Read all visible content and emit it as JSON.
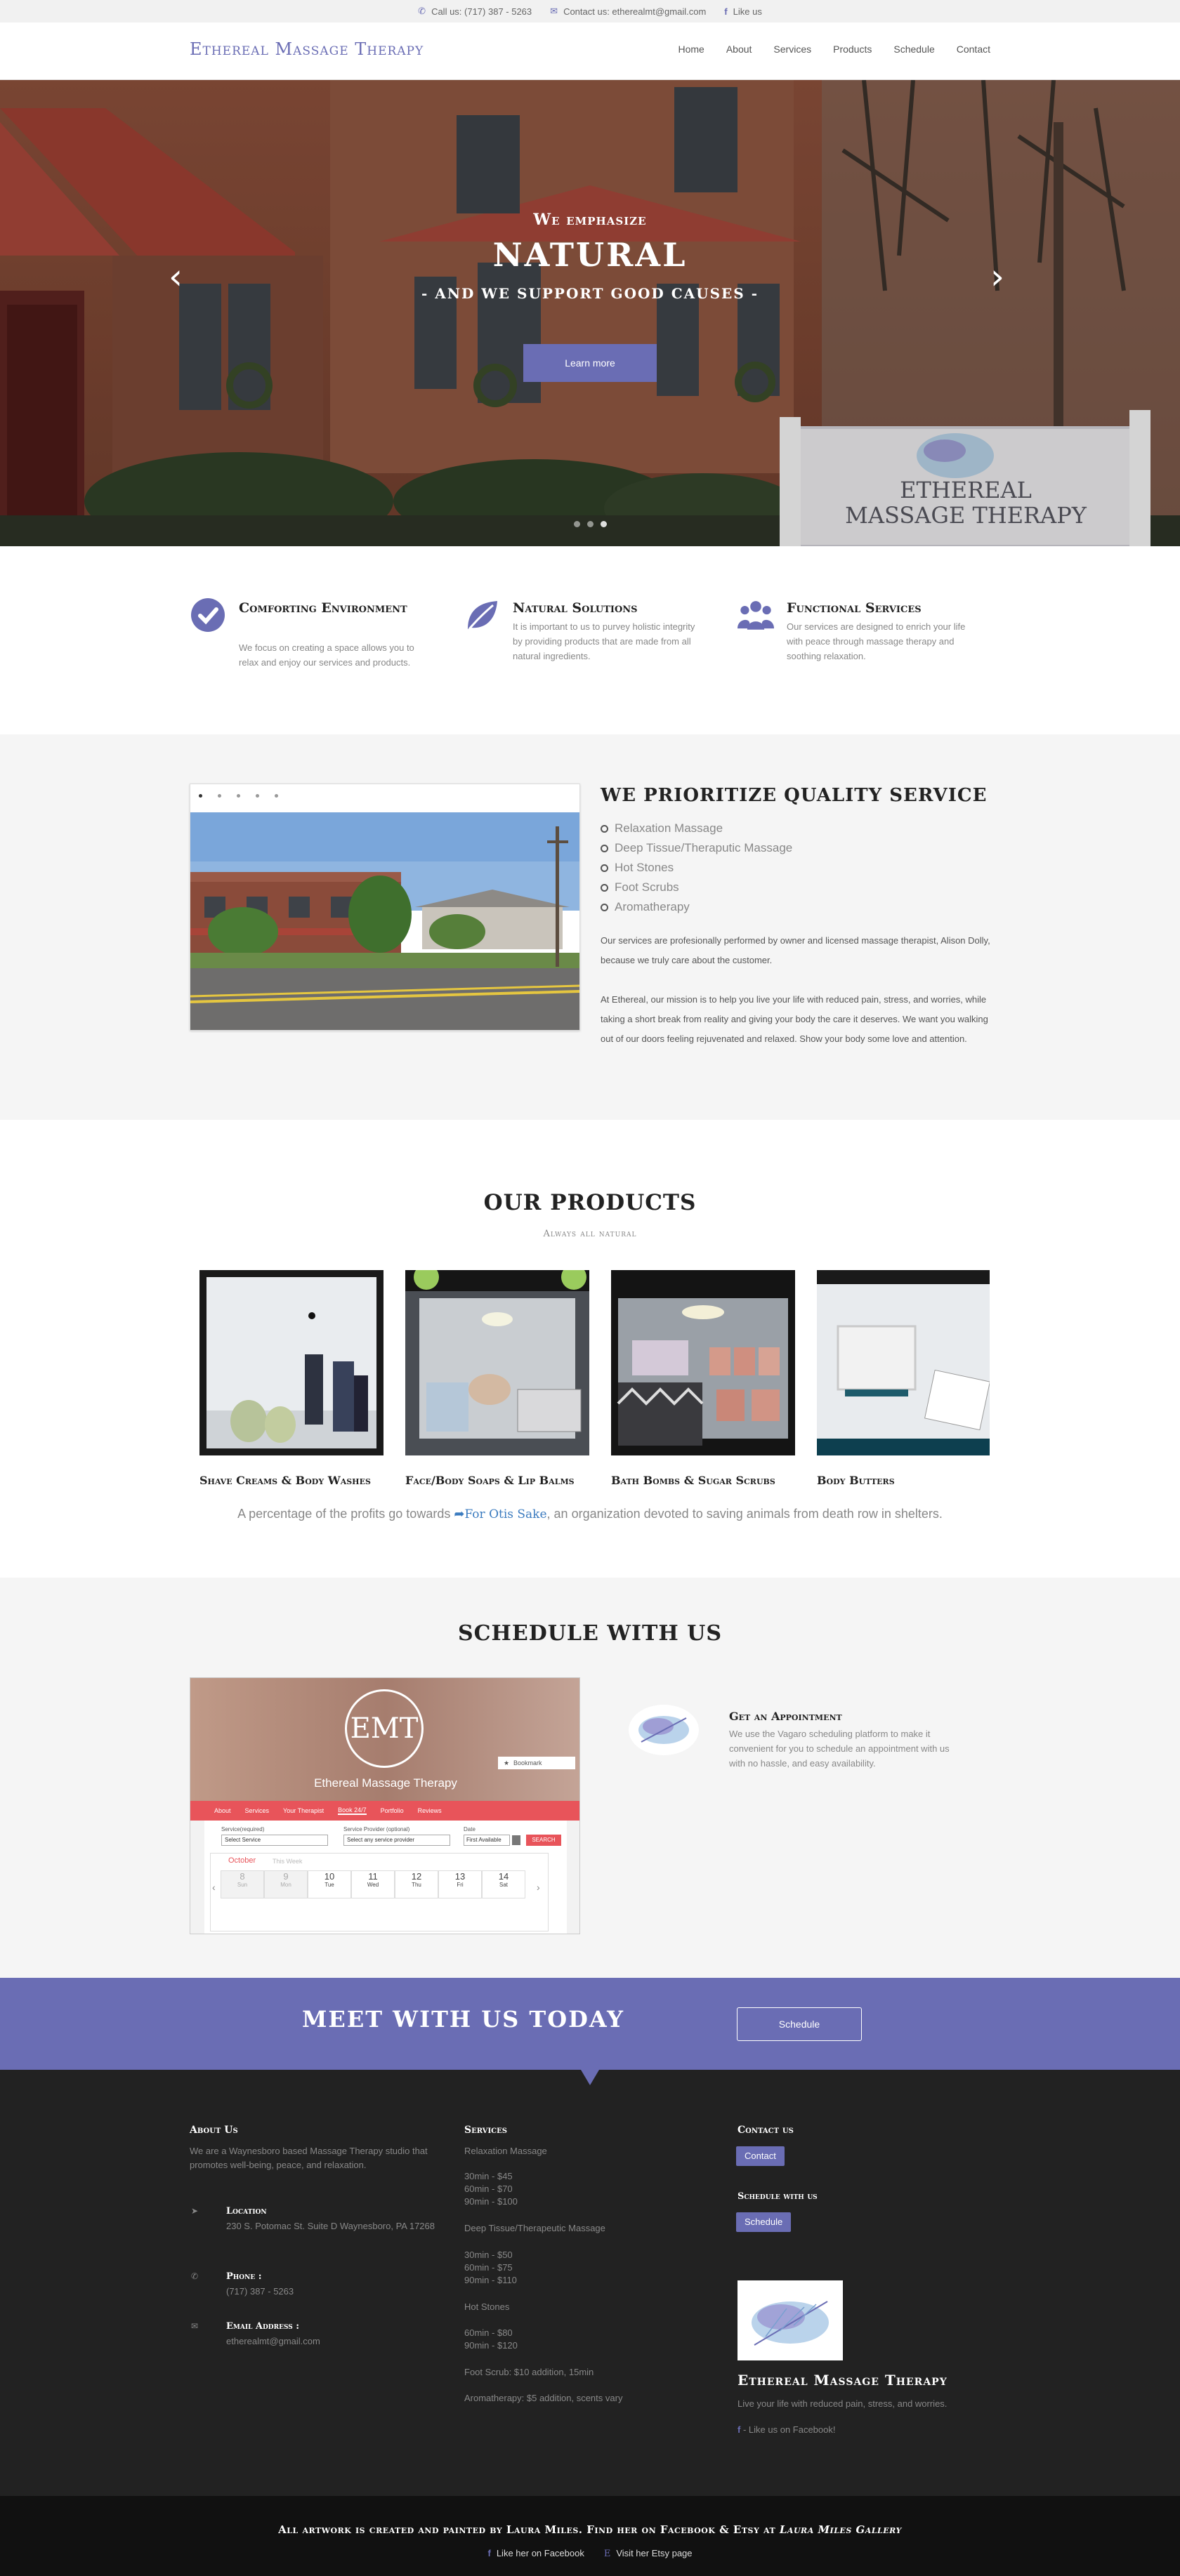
{
  "topbar": {
    "phone_icon": "phone-icon",
    "phone": "Call us: (717) 387 - 5263",
    "email_icon": "envelope-icon",
    "email": "Contact us: etherealmt@gmail.com",
    "like_icon": "facebook-icon",
    "like": "Like us"
  },
  "header": {
    "logo": "Ethereal Massage Therapy",
    "nav": [
      "Home",
      "About",
      "Services",
      "Products",
      "Schedule",
      "Contact"
    ]
  },
  "hero": {
    "line1": "We emphasize",
    "line2": "NATURAL",
    "line3": "- AND WE SUPPORT GOOD CAUSES -",
    "button": "Learn more",
    "sign_line1": "ETHEREAL",
    "sign_line2": "MASSAGE THERAPY",
    "slides": 3,
    "active_slide": 3
  },
  "features": [
    {
      "icon": "check-circle-icon",
      "title": "Comforting Environment",
      "text": "We focus on creating a space allows you to relax and enjoy our services and products."
    },
    {
      "icon": "leaf-icon",
      "title": "Natural Solutions",
      "text": "It is important to us to purvey holistic integrity by providing products that are made from all natural ingredients."
    },
    {
      "icon": "users-icon",
      "title": "Functional Services",
      "text": "Our services are designed to enrich your life with peace through massage therapy and soothing relaxation."
    }
  ],
  "quality": {
    "title": "WE PRIORITIZE QUALITY SERVICE",
    "list": [
      "Relaxation Massage",
      "Deep Tissue/Theraputic Massage",
      "Hot Stones",
      "Foot Scrubs",
      "Aromatherapy"
    ],
    "para1": "Our services are profesionally performed by owner and licensed massage therapist, Alison Dolly, because we truly care about the customer.",
    "para2": "At Ethereal, our mission is to help you live your life with reduced pain, stress, and worries, while taking a short break from reality and giving your body the care it deserves. We want you walking out of our doors feeling rejuvenated and relaxed. Show your body some love and attention.",
    "slides": 5,
    "active_slide": 1
  },
  "products": {
    "title": "OUR PRODUCTS",
    "subtitle": "Always all natural",
    "items": [
      "Shave Creams & Body Washes",
      "Face/Body Soaps & Lip Balms",
      "Bath Bombs & Sugar Scrubs",
      "Body Butters"
    ],
    "note_before": "A percentage of the profits go towards ",
    "note_link": "For Otis Sake",
    "note_after": ", an organization devoted to saving animals from death row in shelters."
  },
  "schedule": {
    "title": "SCHEDULE WITH US",
    "shot": {
      "logo": "EMT",
      "name": "Ethereal Massage Therapy",
      "bookmark": "Bookmark",
      "tabs": [
        "About",
        "Services",
        "Your Therapist",
        "Book 24/7",
        "Portfolio",
        "Reviews"
      ],
      "f1_label": "Service(required)",
      "f1_value": "Select Service",
      "f2_label": "Service Provider (optional)",
      "f2_value": "Select any service provider",
      "f3_label": "Date",
      "f3_value": "First Available",
      "search": "SEARCH",
      "month": "October",
      "month_note": "This Week",
      "days": [
        {
          "n": "8",
          "d": "Sun"
        },
        {
          "n": "9",
          "d": "Mon"
        },
        {
          "n": "10",
          "d": "Tue"
        },
        {
          "n": "11",
          "d": "Wed"
        },
        {
          "n": "12",
          "d": "Thu"
        },
        {
          "n": "13",
          "d": "Fri"
        },
        {
          "n": "14",
          "d": "Sat"
        }
      ]
    },
    "appt_title": "Get an Appointment",
    "appt_text": "We use the Vagaro scheduling platform to make it convenient for you to schedule an appointment with us with no hassle, and easy availability."
  },
  "meet": {
    "title": "MEET WITH US TODAY",
    "button": "Schedule"
  },
  "footer": {
    "about_title": "About Us",
    "about_text": "We are a Waynesboro based Massage Therapy studio that promotes well-being, peace, and relaxation.",
    "location_label": "Location",
    "location_value": "230 S. Potomac St. Suite D Waynesboro, PA 17268",
    "phone_label": "Phone :",
    "phone_value": "(717) 387 - 5263",
    "email_label": "Email Address :",
    "email_value": "etherealmt@gmail.com",
    "services_title": "Services",
    "services": [
      "Relaxation Massage",
      "30min - $45",
      "60min - $70",
      "90min - $100",
      "Deep Tissue/Therapeutic Massage",
      "30min - $50",
      "60min - $75",
      "90min - $110",
      "Hot Stones",
      "60min - $80",
      "90min - $120",
      "Foot Scrub: $10 addition, 15min",
      "Aromatherapy: $5 addition, scents vary"
    ],
    "contact_title": "Contact us",
    "contact_button": "Contact",
    "schedule_title": "Schedule with us",
    "schedule_button": "Schedule",
    "brand": "Ethereal Massage Therapy",
    "brand_text": "Live your life with reduced pain, stress, and worries.",
    "facebook": "- Like us on Facebook!"
  },
  "bottom": {
    "credit_before": "All artwork is created and painted by Laura Miles. Find her on Facebook & Etsy at ",
    "credit_em": "Laura Miles Gallery",
    "fb": "Like her on Facebook",
    "etsy": "Visit her Etsy page"
  },
  "colors": {
    "accent": "#6a6db4",
    "footer": "#222222",
    "bottom": "#111111",
    "link": "#3b7bbf"
  }
}
